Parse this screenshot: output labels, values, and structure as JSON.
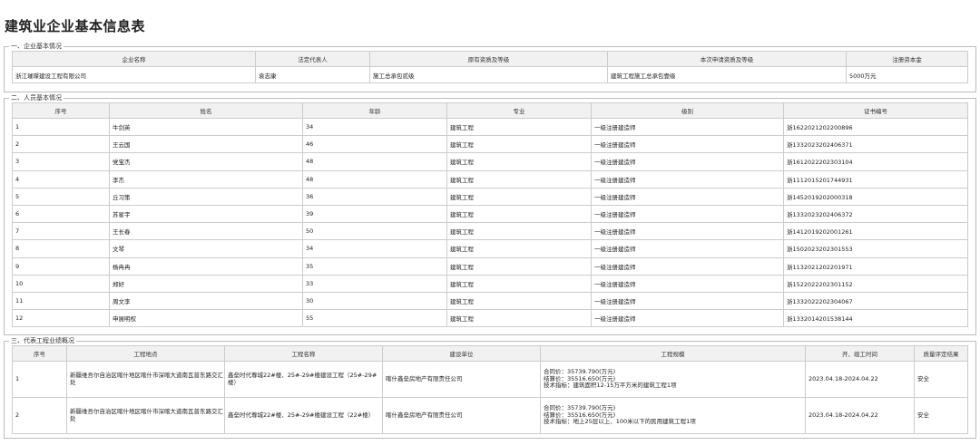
{
  "title": "建筑业企业基本信息表",
  "section1": {
    "legend": "一、企业基本情况",
    "headers": [
      "企业名称",
      "法定代表人",
      "原有资质及等级",
      "本次申请资质及等级",
      "注册资本金"
    ],
    "row": [
      "浙江璀璨建设工程有限公司",
      "袁志康",
      "施工总承包贰级",
      "建筑工程施工总承包壹级",
      "5000万元"
    ]
  },
  "section2": {
    "legend": "二、人员基本情况",
    "headers": [
      "序号",
      "姓名",
      "年龄",
      "专业",
      "级别",
      "证书编号"
    ],
    "rows": [
      [
        "1",
        "牛剑英",
        "34",
        "建筑工程",
        "一级注册建造师",
        "浙1622021202200896"
      ],
      [
        "2",
        "王云国",
        "46",
        "建筑工程",
        "一级注册建造师",
        "浙1332023202406371"
      ],
      [
        "3",
        "党宝杰",
        "48",
        "建筑工程",
        "一级注册建造师",
        "浙1612022202303104"
      ],
      [
        "4",
        "李杰",
        "48",
        "建筑工程",
        "一级注册建造师",
        "浙1112015201744931"
      ],
      [
        "5",
        "丘习策",
        "36",
        "建筑工程",
        "一级注册建造师",
        "浙1452019202000318"
      ],
      [
        "6",
        "苏星宇",
        "39",
        "建筑工程",
        "一级注册建造师",
        "浙1332023202406372"
      ],
      [
        "7",
        "王长春",
        "50",
        "建筑工程",
        "一级注册建造师",
        "浙1412019202001261"
      ],
      [
        "8",
        "文琴",
        "34",
        "建筑工程",
        "一级注册建造师",
        "浙1502023202301553"
      ],
      [
        "9",
        "杨冉冉",
        "35",
        "建筑工程",
        "一级注册建造师",
        "浙1132021202201971"
      ],
      [
        "10",
        "郑好",
        "33",
        "建筑工程",
        "一级注册建造师",
        "浙1522022202301152"
      ],
      [
        "11",
        "周文李",
        "30",
        "建筑工程",
        "一级注册建造师",
        "浙1332022202304067"
      ],
      [
        "12",
        "申展明权",
        "55",
        "建筑工程",
        "一级注册建造师",
        "浙1332014201538144"
      ]
    ]
  },
  "section3": {
    "legend": "三、代表工程业绩概况",
    "headers": [
      "序号",
      "工程地点",
      "工程名称",
      "建设单位",
      "工程规模",
      "开、竣工时间",
      "质量评定结果"
    ],
    "rows": [
      {
        "no": "1",
        "location": "新疆维吾尔自治区喀什地区喀什市深喀大道南瓦普东路交汇处",
        "name": "鑫垒时代尊城22#楼、25#-29#楼建设工程（25#-29#楼）",
        "owner": "喀什鑫垒房地产有限责任公司",
        "scale": [
          "合同价：35739.790(万元)",
          "结算价：35516.650(万元)",
          "技术指标：建筑面积12-15万平方米的建筑工程1项"
        ],
        "period": "2023.04.18-2024.04.22",
        "quality": "安全"
      },
      {
        "no": "2",
        "location": "新疆维吾尔自治区喀什地区喀什市深喀大道南瓦普东路交汇处",
        "name": "鑫垒时代尊城22#楼、25#-29#楼建设工程（22#楼）",
        "owner": "喀什鑫垒房地产有限责任公司",
        "scale": [
          "合同价：35739.790(万元)",
          "结算价：35516.650(万元)",
          "技术指标：地上25层以上、100米以下的民用建筑工程1项"
        ],
        "period": "2023.04.18-2024.04.22",
        "quality": "安全"
      }
    ]
  }
}
